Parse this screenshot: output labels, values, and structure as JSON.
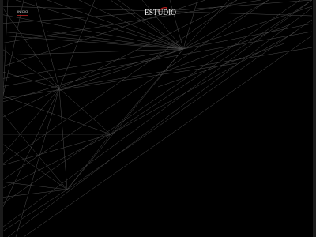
{
  "nav": {
    "home_label": "INICIO"
  },
  "brand": {
    "logo_text": "ESTUDIO",
    "accent_color": "#b11a1a"
  },
  "theme": {
    "background": "#000000",
    "line_color": "#5a5a5a"
  }
}
